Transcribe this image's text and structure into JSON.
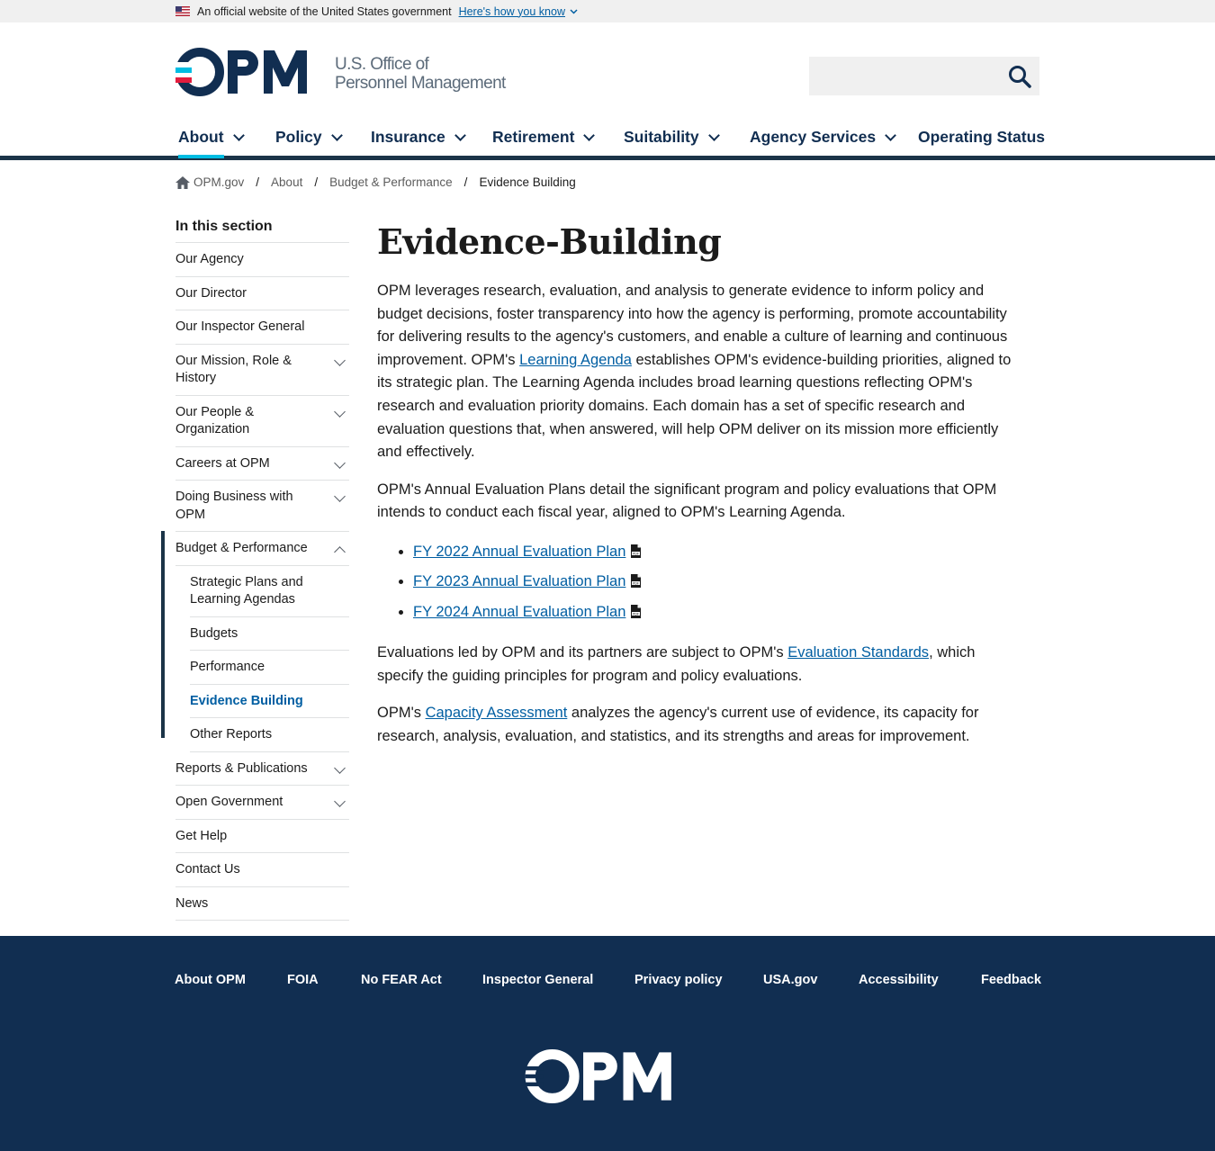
{
  "banner": {
    "official_text": "An official website of the United States government",
    "how_know": "Here's how you know"
  },
  "header": {
    "logo_mark": "OPM",
    "logo_line1": "U.S. Office of",
    "logo_line2": "Personnel Management",
    "search_placeholder": ""
  },
  "nav": {
    "items": [
      {
        "label": "About"
      },
      {
        "label": "Policy"
      },
      {
        "label": "Insurance"
      },
      {
        "label": "Retirement"
      },
      {
        "label": "Suitability"
      },
      {
        "label": "Agency Services"
      },
      {
        "label": "Operating Status"
      }
    ]
  },
  "breadcrumb": {
    "home": "OPM.gov",
    "sep": "/",
    "items": [
      "About",
      "Budget & Performance"
    ],
    "current": "Evidence Building"
  },
  "sidenav": {
    "heading": "In this section",
    "items": [
      {
        "label": "Our Agency"
      },
      {
        "label": "Our Director"
      },
      {
        "label": "Our Inspector General"
      },
      {
        "label": "Our Mission, Role & History"
      },
      {
        "label": "Our People & Organization"
      },
      {
        "label": "Careers at OPM"
      },
      {
        "label": "Doing Business with OPM"
      },
      {
        "label": "Budget & Performance"
      },
      {
        "label": "Reports & Publications"
      },
      {
        "label": "Open Government"
      },
      {
        "label": "Get Help"
      },
      {
        "label": "Contact Us"
      },
      {
        "label": "News"
      }
    ],
    "sub_items": [
      {
        "label": "Strategic Plans and Learning Agendas"
      },
      {
        "label": "Budgets"
      },
      {
        "label": "Performance"
      },
      {
        "label": "Evidence Building"
      },
      {
        "label": "Other Reports"
      }
    ]
  },
  "main": {
    "title": "Evidence-Building",
    "p1_a": "OPM leverages research, evaluation, and analysis to generate evidence to inform policy and budget decisions, foster transparency into how the agency is performing, promote accountability for delivering results to the agency's customers, and enable a culture of learning and continuous improvement. OPM's ",
    "p1_link": "Learning Agenda",
    "p1_b": " establishes OPM's evidence-building priorities, aligned to its strategic plan. The Learning Agenda includes broad learning questions reflecting OPM's research and evaluation priority domains. Each domain has a set of specific research and evaluation questions that, when answered, will help OPM deliver on its mission more efficiently and effectively.",
    "p2": "OPM's Annual Evaluation Plans detail the significant program and policy evaluations that OPM intends to conduct each fiscal year, aligned to OPM's Learning Agenda.",
    "plans": [
      {
        "label": "FY 2022 Annual Evaluation Plan"
      },
      {
        "label": "FY 2023 Annual Evaluation Plan"
      },
      {
        "label": "FY 2024 Annual Evaluation Plan"
      }
    ],
    "p3_a": "Evaluations led by OPM and its partners are subject to OPM's ",
    "p3_link": "Evaluation Standards",
    "p3_b": ", which specify the guiding principles for program and policy evaluations.",
    "p4_a": "OPM's ",
    "p4_link": "Capacity Assessment",
    "p4_b": " analyzes the agency's current use of evidence, its capacity for research, analysis, evaluation, and statistics, and its strengths and areas for improvement."
  },
  "footer": {
    "links": [
      {
        "label": "About OPM"
      },
      {
        "label": "FOIA"
      },
      {
        "label": "No FEAR Act"
      },
      {
        "label": "Inspector General"
      },
      {
        "label": "Privacy policy"
      },
      {
        "label": "USA.gov"
      },
      {
        "label": "Accessibility"
      },
      {
        "label": "Feedback"
      }
    ],
    "logo_mark": "OPM"
  },
  "colors": {
    "navy": "#112e51",
    "link_blue": "#005ea2",
    "accent_cyan": "#00bde3",
    "logo_red": "#e31c3d"
  }
}
